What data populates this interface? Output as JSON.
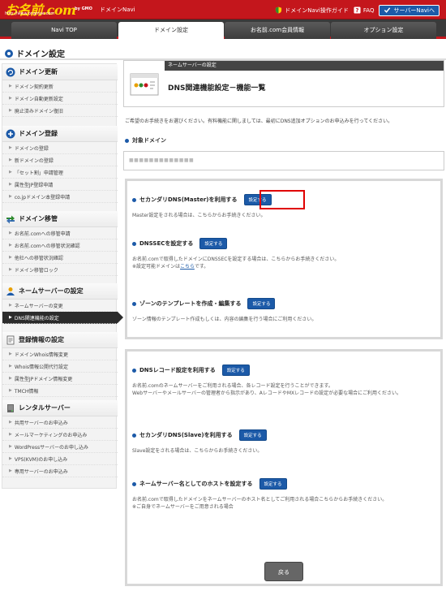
{
  "header": {
    "brand": "お名前.com",
    "url_text": "http://www.onamae.com",
    "gmo": "by GMO",
    "product": "ドメインNavi",
    "links": [
      {
        "label": "ドメインNavi操作ガイド"
      },
      {
        "label": "FAQ"
      },
      {
        "label": "サーバーNaviへ"
      }
    ]
  },
  "tabs": [
    {
      "label": "Navi TOP"
    },
    {
      "label": "ドメイン設定"
    },
    {
      "label": "お名前.com会員情報"
    },
    {
      "label": "オプション設定"
    }
  ],
  "page_title": "ドメイン設定",
  "sidebar": {
    "groups": [
      {
        "title": "ドメイン更新",
        "items": [
          "ドメイン契約更新",
          "ドメイン自動更新設定",
          "廃止済みドメイン復旧"
        ]
      },
      {
        "title": "ドメイン登録",
        "items": [
          "ドメインの登録",
          "新ドメインの登録",
          "「セット割」申請管理",
          "属性型JP登録申請",
          "co.jpドメイン本登録申請"
        ]
      },
      {
        "title": "ドメイン移管",
        "items": [
          "お名前.comへの移管申請",
          "お名前.comへの移管状況確認",
          "他社への移管状況確認",
          "ドメイン移管ロック"
        ]
      },
      {
        "title": "ネームサーバーの設定",
        "items": [
          "ネームサーバーの変更",
          "DNS関連機能の設定"
        ]
      },
      {
        "title": "登録情報の設定",
        "items": [
          "ドメインWhois情報変更",
          "Whois情報公開代行設定",
          "属性型JPドメイン情報変更",
          "TMCH情報"
        ]
      },
      {
        "title": "レンタルサーバー",
        "items": [
          "共用サーバーのお申込み",
          "メールマーケティングのお申込み",
          "WordPressサーバーのお申し込み",
          "VPS(KVM)のお申し込み",
          "専用サーバーのお申込み"
        ]
      }
    ]
  },
  "hero": {
    "band": "ネームサーバーの設定",
    "title": "DNS関連機能設定－機能一覧"
  },
  "intro": "ご希望のお手続きをお選びください。有料機能に関しましては、最初にDNS追加オプションのお申込みを行ってください。",
  "target": {
    "label": "対象ドメイン",
    "value": "■■■■■■■■■■■■■"
  },
  "panel1": [
    {
      "label": "セカンダリDNS(Master)を利用する",
      "button": "設定する",
      "desc": [
        "Master設定をされる場合は、こちらからお手続きください。"
      ]
    },
    {
      "label": "DNSSECを設定する",
      "button": "設定する",
      "desc": [
        "お名前.comで取得したドメインにDNSSECを設定する場合は、こちらからお手続きください。"
      ],
      "desc2_prefix": "※設定可能ドメインは",
      "desc2_link": "こちら",
      "desc2_suffix": "です。"
    },
    {
      "label": "ゾーンのテンプレートを作成・編集する",
      "button": "設定する",
      "desc": [
        "ゾーン情報のテンプレート作成もしくは、内容の編集を行う場合にご利用ください。"
      ]
    }
  ],
  "panel2": [
    {
      "label": "DNSレコード設定を利用する",
      "button": "設定する",
      "desc": [
        "お名前.comのネームサーバーをご利用される場合、各レコード設定を行うことができます。",
        "Webサーバーやメールサーバーの管理者から指示があり、AレコードやMXレコードの設定が必要な場合にご利用ください。"
      ]
    },
    {
      "label": "セカンダリDNS(Slave)を利用する",
      "button": "設定する",
      "desc": [
        "Slave設定をされる場合は、こちらからお手続きください。"
      ]
    },
    {
      "label": "ネームサーバー名としてのホストを設定する",
      "button": "設定する",
      "desc": [
        "お名前.comで取得したドメインをネームサーバーのホスト名としてご利用される場合こちらからお手続きください。",
        "※ご自身でネームサーバーをご用意される場合"
      ]
    }
  ],
  "back_label": "戻る",
  "colors": {
    "brand_red": "#c4161c",
    "accent_blue": "#1c5aa8",
    "highlight": "#e00000"
  }
}
